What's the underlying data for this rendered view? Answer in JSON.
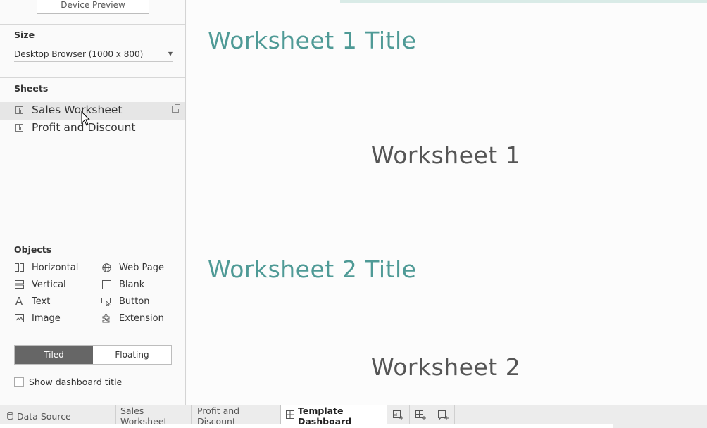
{
  "left_panel": {
    "device_preview_label": "Device Preview",
    "size": {
      "title": "Size",
      "selected": "Desktop Browser (1000 x 800)"
    },
    "sheets": {
      "title": "Sheets",
      "items": [
        {
          "label": "Sales Worksheet",
          "selected": true
        },
        {
          "label": "Profit and Discount",
          "selected": false
        }
      ]
    },
    "objects": {
      "title": "Objects",
      "items": [
        {
          "label": "Horizontal",
          "icon": "horizontal-icon"
        },
        {
          "label": "Web Page",
          "icon": "globe-icon"
        },
        {
          "label": "Vertical",
          "icon": "vertical-icon"
        },
        {
          "label": "Blank",
          "icon": "blank-icon"
        },
        {
          "label": "Text",
          "icon": "text-icon"
        },
        {
          "label": "Button",
          "icon": "button-icon"
        },
        {
          "label": "Image",
          "icon": "image-icon"
        },
        {
          "label": "Extension",
          "icon": "puzzle-icon"
        }
      ]
    },
    "layout_mode": {
      "tiled": "Tiled",
      "floating": "Floating",
      "active": "Tiled"
    },
    "show_dashboard_title": {
      "label": "Show dashboard title",
      "checked": false
    }
  },
  "canvas": {
    "worksheet1_title": "Worksheet 1 Title",
    "worksheet1_placeholder": "Worksheet 1",
    "worksheet2_title": "Worksheet 2 Title",
    "worksheet2_placeholder": "Worksheet 2"
  },
  "tabs": {
    "data_source": "Data Source",
    "items": [
      {
        "label": "Sales Worksheet"
      },
      {
        "label": "Profit and Discount"
      },
      {
        "label": "Template Dashboard",
        "active": true
      }
    ]
  },
  "colors": {
    "title_teal": "#4f9a96",
    "toggle_active": "#666666"
  }
}
